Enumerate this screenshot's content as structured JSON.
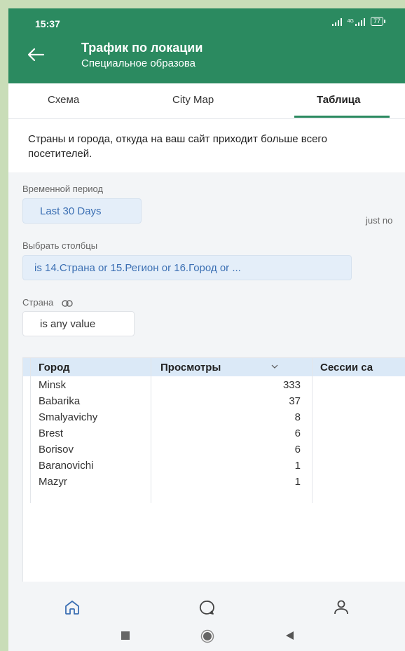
{
  "status": {
    "time": "15:37",
    "battery": "77",
    "network": "4G"
  },
  "header": {
    "title": "Трафик по локации",
    "subtitle": "Специальное образова"
  },
  "tabs": [
    {
      "label": "Схема",
      "active": false
    },
    {
      "label": "City Map",
      "active": false
    },
    {
      "label": "Таблица",
      "active": true
    }
  ],
  "description": "Страны и города, откуда на ваш сайт приходит больше всего посетителей.",
  "filters": {
    "period_label": "Временной период",
    "period_value": "Last 30 Days",
    "updated": "just no",
    "columns_label": "Выбрать столбцы",
    "columns_value": "is 14.Страна or 15.Регион or 16.Город or ...",
    "country_label": "Страна",
    "country_value": "is any value"
  },
  "table": {
    "headers": [
      "Город",
      "Просмотры",
      "Сессии са"
    ],
    "rows": [
      {
        "city": "Minsk",
        "views": "333"
      },
      {
        "city": "Babarika",
        "views": "37"
      },
      {
        "city": "Smalyavichy",
        "views": "8"
      },
      {
        "city": "Brest",
        "views": "6"
      },
      {
        "city": "Borisov",
        "views": "6"
      },
      {
        "city": "Baranovichi",
        "views": "1"
      },
      {
        "city": "Mazyr",
        "views": "1"
      }
    ]
  },
  "nav": {
    "items": [
      "home-icon",
      "chat-icon",
      "profile-icon"
    ]
  },
  "colors": {
    "brand": "#2b8a60",
    "chip_text": "#3b6fb3",
    "chip_bg": "#e4eef9",
    "table_header": "#dbe9f7"
  }
}
